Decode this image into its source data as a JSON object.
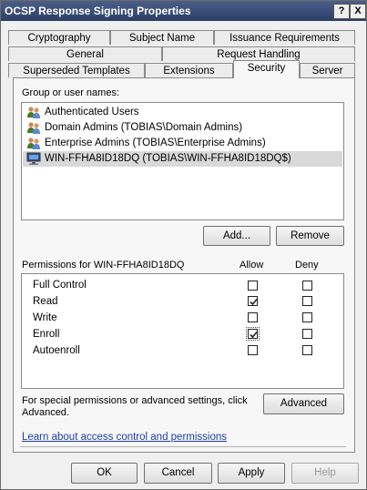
{
  "window": {
    "title": "OCSP Response Signing Properties",
    "help_btn": "?",
    "close_btn": "X"
  },
  "tabs": {
    "row1": [
      "Cryptography",
      "Subject Name",
      "Issuance Requirements"
    ],
    "row2": [
      "General",
      "Request Handling"
    ],
    "row3": [
      "Superseded Templates",
      "Extensions",
      "Security",
      "Server"
    ]
  },
  "security": {
    "group_label": "Group or user names:",
    "users": [
      "Authenticated Users",
      "Domain Admins (TOBIAS\\Domain Admins)",
      "Enterprise Admins (TOBIAS\\Enterprise Admins)",
      "WIN-FFHA8ID18DQ (TOBIAS\\WIN-FFHA8ID18DQ$)"
    ],
    "add_btn": "Add...",
    "remove_btn": "Remove",
    "permissions_for": "Permissions for WIN-FFHA8ID18DQ",
    "allow_header": "Allow",
    "deny_header": "Deny",
    "permissions": [
      {
        "name": "Full Control",
        "allow": false,
        "deny": false
      },
      {
        "name": "Read",
        "allow": true,
        "deny": false
      },
      {
        "name": "Write",
        "allow": false,
        "deny": false
      },
      {
        "name": "Enroll",
        "allow": true,
        "deny": false
      },
      {
        "name": "Autoenroll",
        "allow": false,
        "deny": false
      }
    ],
    "special_text_1": "For special permissions or advanced settings, click",
    "special_text_2": "Advanced.",
    "advanced_btn": "Advanced",
    "learn_link": "Learn about access control and permissions"
  },
  "buttons": {
    "ok": "OK",
    "cancel": "Cancel",
    "apply": "Apply",
    "help": "Help"
  }
}
